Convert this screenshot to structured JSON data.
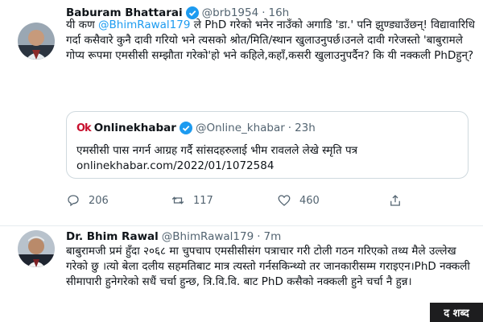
{
  "tweet1": {
    "author_name": "Baburam Bhattarai",
    "handle": "@brb1954",
    "separator": "·",
    "time": "16h",
    "text_prefix": "यी कण ",
    "mention": "@BhimRawal179",
    "text_rest": " ले PhD गरेको भनेर नाउँको अगाडि 'डा.' पनि झुण्ड्याउँछन्! विद्यावारिधि गर्दा कसैवारे कुनै दावी गरियो भने त्यसको श्रोत/मिति/स्थान खुलाउनुपर्छ।उनले दावी गरेजस्तो 'बाबुरामले गोप्य रूपमा एमसीसी सम्झौता गरेको'हो भने कहिले,कहाँ,कसरी खुलाउनुपर्दैन? कि यी नक्कली PhDहुन्?",
    "quote": {
      "logo": "Ok",
      "name": "Onlinekhabar",
      "handle": "@Online_khabar",
      "separator": "·",
      "time": "23h",
      "text": "एमसीसी पास नगर्न आग्रह गर्दै सांसदहरुलाई भीम रावलले लेखे स्मृति पत्र",
      "link": "onlinekhabar.com/2022/01/1072584"
    },
    "actions": {
      "reply_count": "206",
      "retweet_count": "117",
      "like_count": "460"
    }
  },
  "tweet2": {
    "author_name": "Dr. Bhim Rawal",
    "handle": "@BhimRawal179",
    "separator": "·",
    "time": "7m",
    "text": "बाबुरामजी प्रमं हुँदा २०६८ मा चुपचाप एमसीसीसंग पत्राचार गरी टोली गठन गरिएको तथ्य मैले उल्लेख गरेको छु ।त्यो बेला दलीय सहमतिबाट मात्र त्यस्तो गर्नसकिन्थ्यो तर जानकारीसम्म गराइएन।PhD नक्कली सीमापारी हुनेगरेको सधैं चर्चा हुन्छ, त्रि.वि.वि. बाट PhD कसैको नक्कली हुने चर्चा  नै हुन्न।"
  },
  "watermark": "द शब्द",
  "colors": {
    "link": "#1d9bf0",
    "verified": "#1d9bf0",
    "secondary_text": "#536471",
    "border": "#cfd9de",
    "onlinekhabar_brand": "#c8102e"
  },
  "icons": [
    "verified-badge-icon",
    "reply-icon",
    "retweet-icon",
    "like-icon",
    "share-icon"
  ]
}
